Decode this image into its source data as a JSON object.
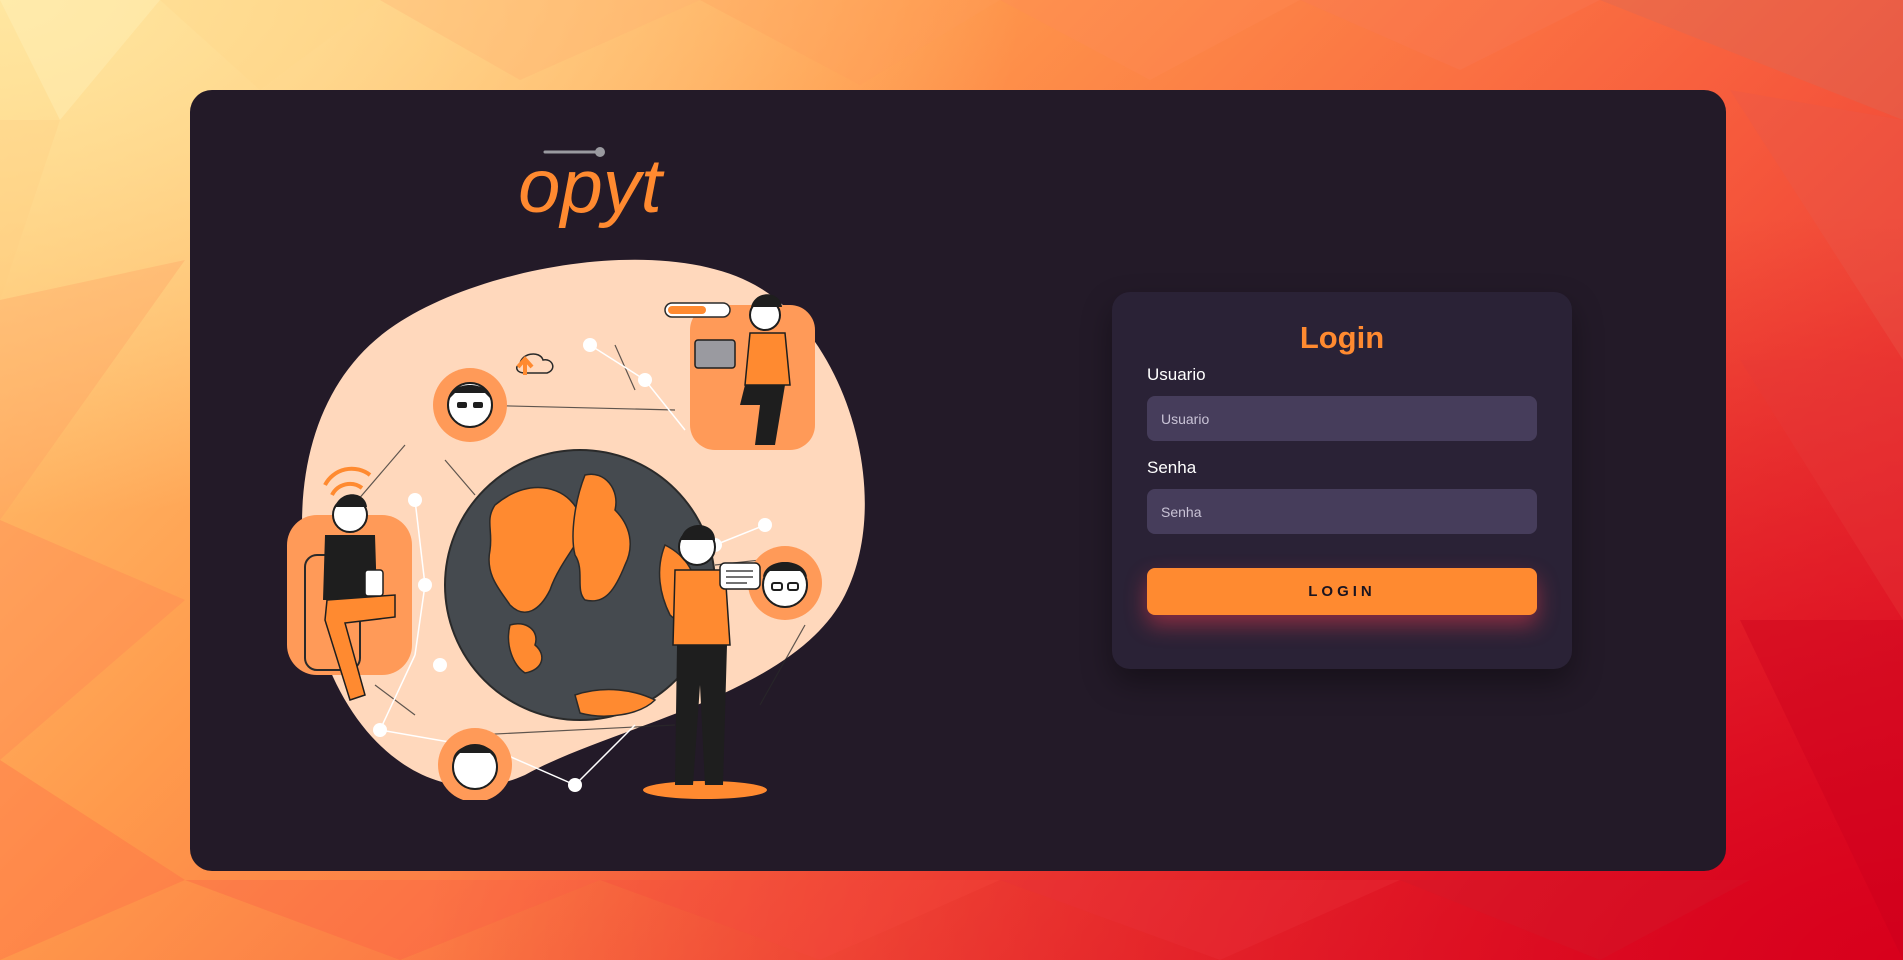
{
  "brand": {
    "logo_text": "opyt",
    "accent_color": "#ff8a30"
  },
  "login": {
    "title": "Login",
    "username_label": "Usuario",
    "username_placeholder": "Usuario",
    "username_value": "",
    "password_label": "Senha",
    "password_placeholder": "Senha",
    "password_value": "",
    "submit_label": "LOGIN"
  }
}
